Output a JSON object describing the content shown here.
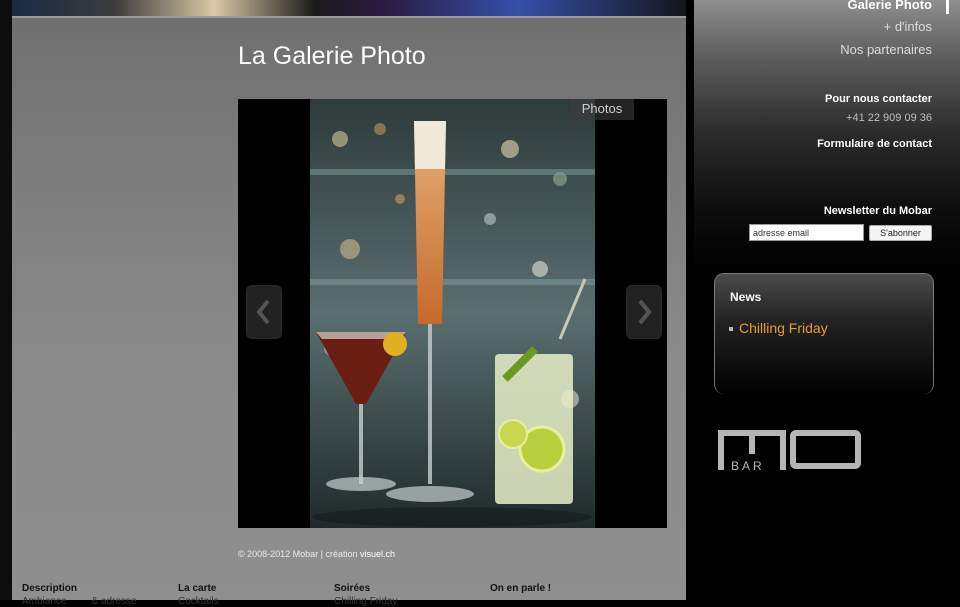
{
  "main": {
    "page_title": "La Galerie Photo",
    "gallery_label": "Photos",
    "copyright_prefix": "© 2008-2012 Mobar | création ",
    "copyright_link": "visuel.ch"
  },
  "footer": {
    "cols": [
      {
        "title": "Description",
        "sub": "Ambiance"
      },
      {
        "title": "La carte",
        "sub": "Cocktails"
      },
      {
        "title": "Soirées",
        "sub": "Chilling Friday"
      },
      {
        "title": "On en parle !",
        "sub": ""
      }
    ],
    "extra": "& adresse"
  },
  "sidebar": {
    "nav_current": "Galerie Photo",
    "nav_items": [
      "+ d'infos",
      "Nos partenaires"
    ],
    "contact_heading": "Pour nous contacter",
    "phone": "+41 22 909 09 36",
    "contact_form": "Formulaire de contact",
    "newsletter_heading": "Newsletter du Mobar",
    "email_value": "adresse email",
    "subscribe_label": "S'abonner",
    "news_title": "News",
    "news_items": [
      "Chilling Friday"
    ],
    "logo_text": "BAR"
  },
  "colors": {
    "accent_orange": "#e89a2a",
    "main_gray": "#808080"
  }
}
